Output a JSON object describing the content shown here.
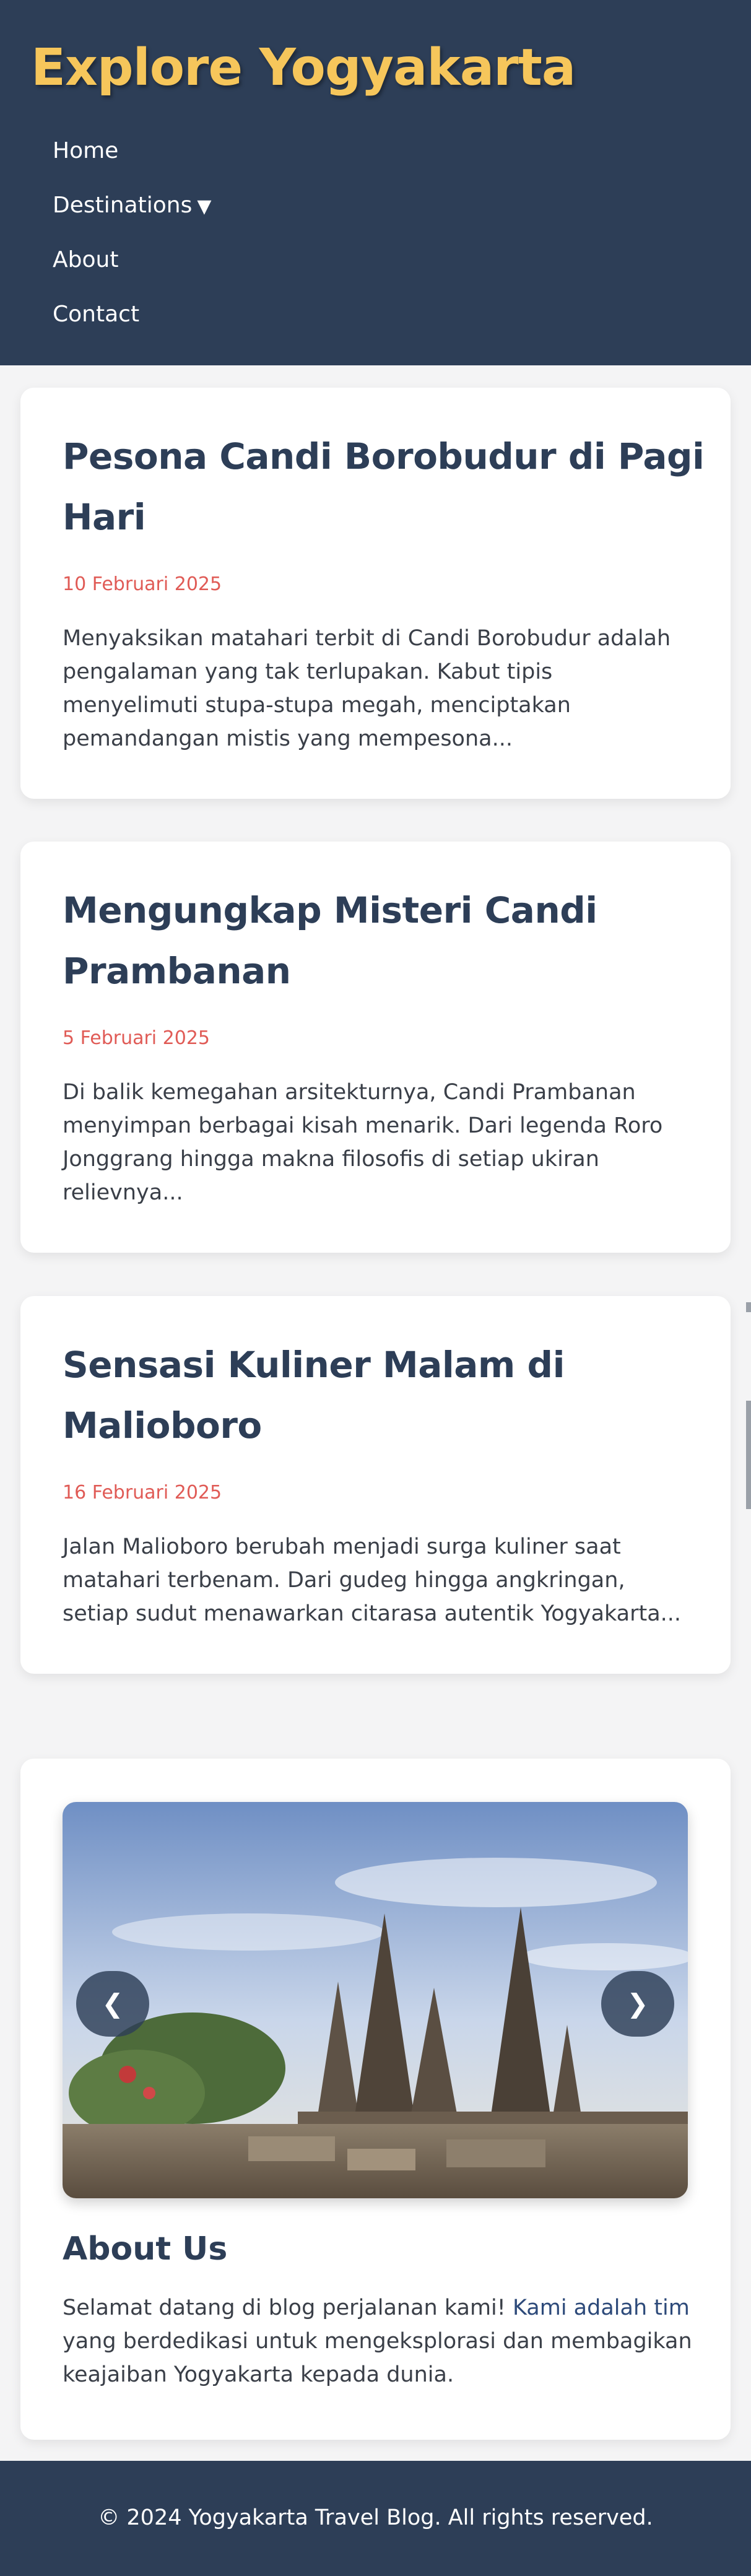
{
  "site": {
    "title": "Explore Yogyakarta"
  },
  "nav": {
    "items": [
      {
        "label": "Home"
      },
      {
        "label": "Destinations",
        "caret": "▼"
      },
      {
        "label": "About"
      },
      {
        "label": "Contact"
      }
    ]
  },
  "posts": [
    {
      "title": "Pesona Candi Borobudur di Pagi Hari",
      "date": "10 Februari 2025",
      "excerpt": "Menyaksikan matahari terbit di Candi Borobudur adalah pengalaman yang tak terlupakan. Kabut tipis menyelimuti stupa-stupa megah, menciptakan pemandangan mistis yang mempesona..."
    },
    {
      "title": "Mengungkap Misteri Candi Prambanan",
      "date": "5 Februari 2025",
      "excerpt": "Di balik kemegahan arsitekturnya, Candi Prambanan menyimpan berbagai kisah menarik. Dari legenda Roro Jonggrang hingga makna filosofis di setiap ukiran relievnya..."
    },
    {
      "title": "Sensasi Kuliner Malam di Malioboro",
      "date": "16 Februari 2025",
      "excerpt": "Jalan Malioboro berubah menjadi surga kuliner saat matahari terbenam. Dari gudeg hingga angkringan, setiap sudut menawarkan citarasa autentik Yogyakarta..."
    }
  ],
  "carousel": {
    "prev_label": "❮",
    "next_label": "❯"
  },
  "about": {
    "title": "About Us",
    "text_before": "Selamat datang di blog perjalanan kami! ",
    "link_text": "Kami adalah tim",
    "text_after": " yang berdedikasi untuk mengeksplorasi dan membagikan keajaiban Yogyakarta kepada dunia."
  },
  "footer": {
    "text": "© 2024 Yogyakarta Travel Blog. All rights reserved."
  },
  "colors": {
    "header_bg": "#2d3e57",
    "title_accent": "#f6c65b",
    "date_red": "#e05b56",
    "page_bg": "#f4f4f5"
  }
}
